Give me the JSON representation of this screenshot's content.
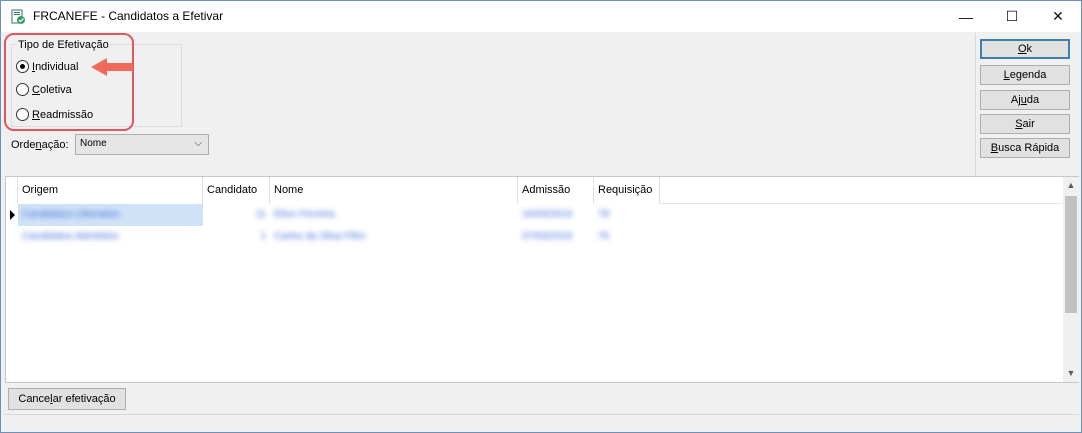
{
  "window": {
    "title": "FRCANEFE - Candidatos a Efetivar",
    "controls": {
      "minimize": "—",
      "maximize": "☐",
      "close": "✕"
    }
  },
  "efetivacao": {
    "group_title": "Tipo de Efetivação",
    "options": [
      {
        "label_pre": "",
        "label_ul": "I",
        "label_post": "ndividual",
        "checked": true
      },
      {
        "label_pre": "",
        "label_ul": "C",
        "label_post": "oletiva",
        "checked": false
      },
      {
        "label_pre": "",
        "label_ul": "R",
        "label_post": "eadmissão",
        "checked": false
      }
    ]
  },
  "ordenacao": {
    "label_pre": "Orde",
    "label_ul": "n",
    "label_post": "ação:",
    "selected": "Nome"
  },
  "buttons": {
    "ok": {
      "pre": "",
      "ul": "O",
      "post": "k"
    },
    "legenda": {
      "pre": "",
      "ul": "L",
      "post": "egenda"
    },
    "ajuda": {
      "pre": "Aj",
      "ul": "u",
      "post": "da"
    },
    "sair": {
      "pre": "",
      "ul": "S",
      "post": "air"
    },
    "busca": {
      "pre": "",
      "ul": "B",
      "post": "usca Rápida"
    },
    "cancelar": {
      "pre": "Cance",
      "ul": "l",
      "post": "ar efetivação"
    }
  },
  "grid": {
    "columns": [
      "Origem",
      "Candidato",
      "Nome",
      "Admissão",
      "Requisição"
    ],
    "rows": [
      [
        "Candidatos Liberados",
        "11",
        "Elton Ferreira",
        "16/03/2019",
        "78"
      ],
      [
        "Candidatos Admitidos",
        "1",
        "Carlos da Silva Filho",
        "07/03/2019",
        "76"
      ]
    ]
  },
  "colors": {
    "accent": "#e0585f",
    "selection": "#cfe2f7",
    "blurred_text": "#3b69d8"
  }
}
